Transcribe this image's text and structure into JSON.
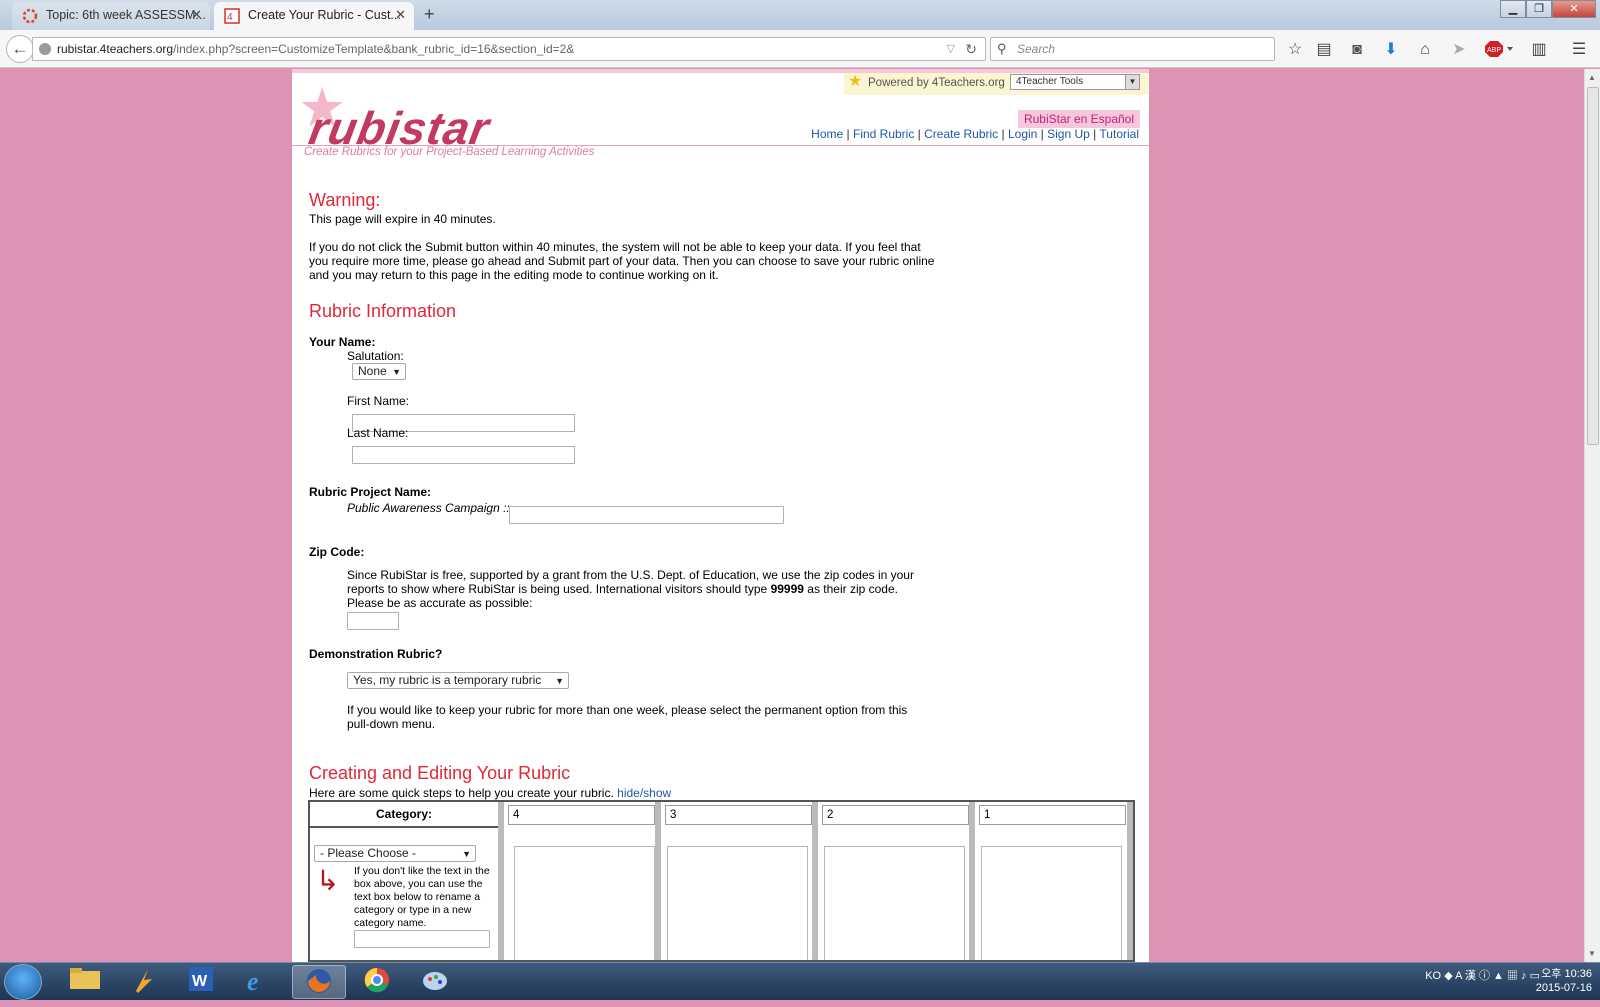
{
  "browser": {
    "tabs": [
      {
        "label": "Topic: 6th week ASSESSM...",
        "active": false
      },
      {
        "label": "Create Your Rubric - Cust...",
        "active": true
      }
    ],
    "url_host": "rubistar.4teachers.org",
    "url_path": "/index.php?screen=CustomizeTemplate&bank_rubric_id=16&section_id=2&",
    "search_placeholder": "Search"
  },
  "header": {
    "powered_by": "Powered by 4Teachers.org",
    "tools_select": "4Teacher Tools",
    "logo_text": "rubistar",
    "tagline": "Create Rubrics for your Project-Based Learning Activities",
    "espanol": "RubiStar en Español",
    "nav": [
      "Home",
      "Find Rubric",
      "Create Rubric",
      "Login",
      "Sign Up",
      "Tutorial"
    ]
  },
  "warning": {
    "title": "Warning:",
    "expire": "This page will expire in 40 minutes.",
    "body_line1": "If you do not click the Submit button within 40 minutes, the system will not be able to keep your data. If you feel that",
    "body_line2": "you require more time, please go ahead and Submit part of your data. Then you can choose to save your rubric online",
    "body_line3": "and you may return to this page in the editing mode to continue working on it."
  },
  "info": {
    "title": "Rubric Information",
    "your_name": "Your Name:",
    "salutation_label": "Salutation:",
    "salutation_value": "None",
    "first_name_label": "First Name:",
    "last_name_label": "Last Name:",
    "project_label": "Rubric Project Name:",
    "project_prefix": "Public Awareness Campaign ::",
    "zip_label": "Zip Code:",
    "zip_line1": "Since RubiStar is free, supported by a grant from the U.S. Dept. of Education, we use the zip codes in your",
    "zip_line2_a": "reports to show where RubiStar is being used. International visitors should type ",
    "zip_line2_b": "99999",
    "zip_line2_c": " as their zip code.",
    "zip_line3": "Please be as accurate as possible:",
    "demo_label": "Demonstration Rubric?",
    "demo_value": "Yes, my rubric is a temporary rubric",
    "demo_line1": "If you would like to keep your rubric for more than one week, please select the permanent option from this",
    "demo_line2": "pull-down menu."
  },
  "editing": {
    "title": "Creating and Editing Your Rubric",
    "intro": "Here are some quick steps to help you create your rubric.",
    "hide_show": "hide/show",
    "category_header": "Category:",
    "levels": [
      "4",
      "3",
      "2",
      "1"
    ],
    "category_select": "- Please Choose -",
    "category_hint": "If you don't like the text in the box above, you can use the text box below to rename a category or type in a new category name."
  },
  "taskbar": {
    "language": "KO",
    "time": "오후 10:36",
    "date": "2015-07-16"
  }
}
